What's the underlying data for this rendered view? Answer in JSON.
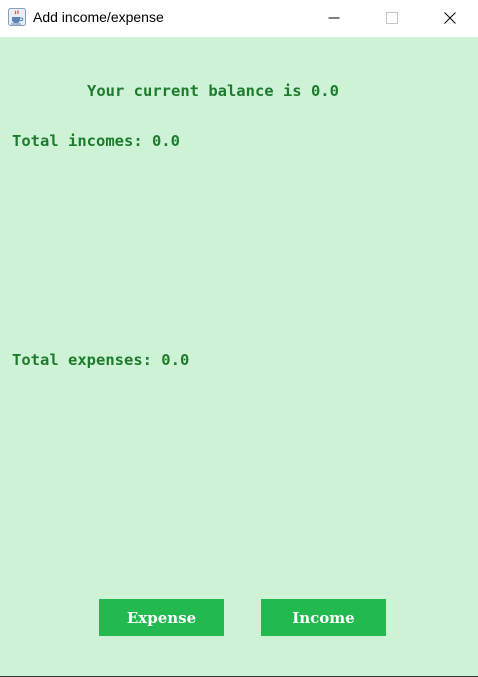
{
  "window": {
    "title": "Add income/expense",
    "icon": "java-cup-icon",
    "controls": [
      "minimize-icon",
      "maximize-icon",
      "close-icon"
    ]
  },
  "content": {
    "background_color": "#cdf2d5",
    "text_color": "#1e7b2d",
    "balance_text": "Your current balance is 0.0",
    "total_incomes_text": "Total incomes: 0.0",
    "total_expenses_text": "Total expenses: 0.0"
  },
  "buttons": {
    "expense_label": "Expense",
    "income_label": "Income",
    "color": "#22b94f"
  }
}
